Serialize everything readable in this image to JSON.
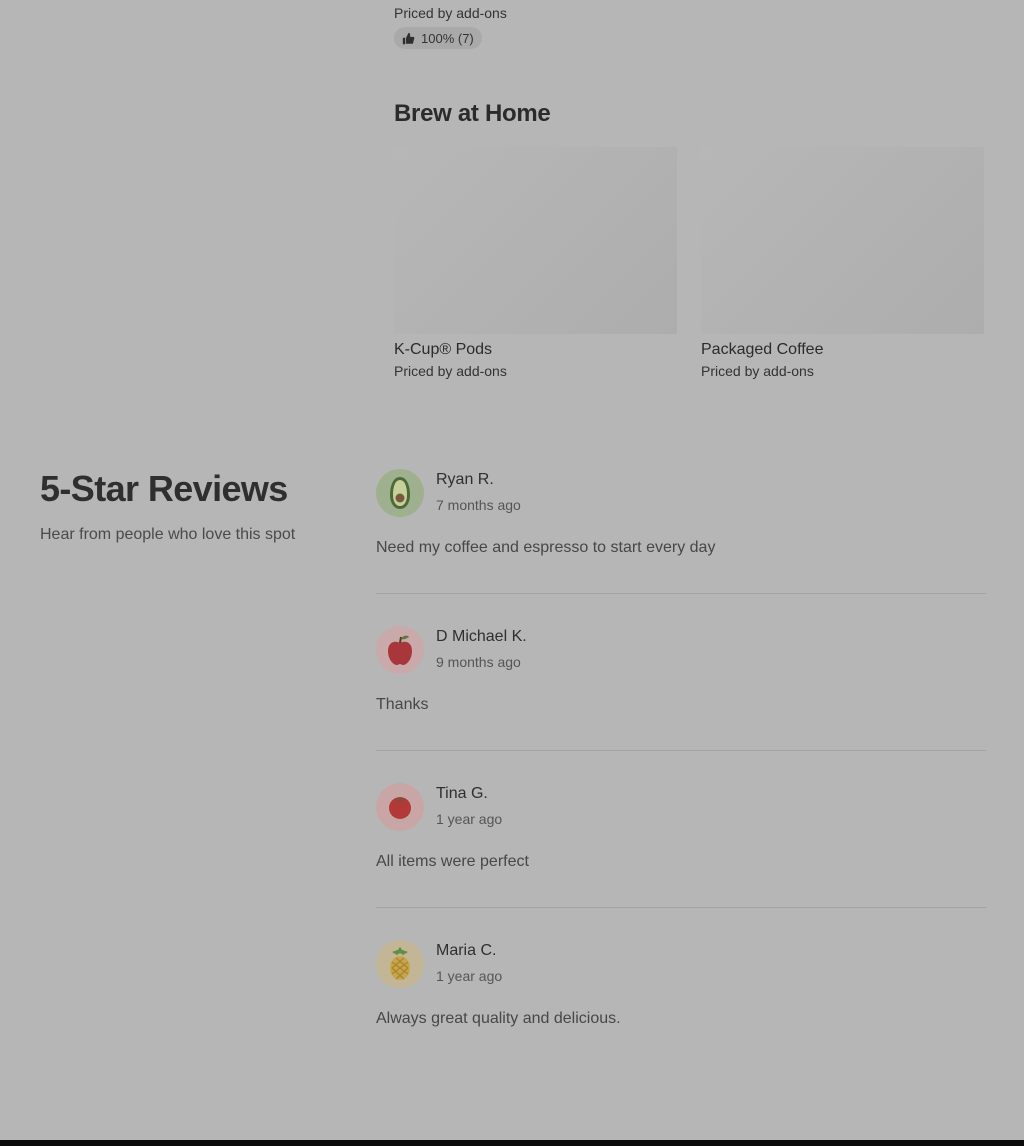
{
  "previous_item": {
    "price_text": "Priced by add-ons",
    "rating_text": "100% (7)",
    "rating_icon": "thumbs-up-icon"
  },
  "brew_at_home": {
    "title": "Brew at Home",
    "items": [
      {
        "name": "K-Cup® Pods",
        "price_text": "Priced by add-ons"
      },
      {
        "name": "Packaged Coffee",
        "price_text": "Priced by add-ons"
      }
    ]
  },
  "reviews": {
    "title": "5-Star Reviews",
    "subtitle": "Hear from people who love this spot",
    "items": [
      {
        "name": "Ryan R.",
        "time": "7 months ago",
        "text": "Need my coffee and espresso to start every day",
        "avatar_icon": "avocado-icon",
        "avatar_bg": "#9fb08e"
      },
      {
        "name": "D Michael K.",
        "time": "9 months ago",
        "text": "Thanks",
        "avatar_icon": "apple-icon",
        "avatar_bg": "#c9a9a9"
      },
      {
        "name": "Tina G.",
        "time": "1 year ago",
        "text": "All items were perfect",
        "avatar_icon": "tomato-icon",
        "avatar_bg": "#c9a6a6"
      },
      {
        "name": "Maria C.",
        "time": "1 year ago",
        "text": "Always great quality and delicious.",
        "avatar_icon": "pineapple-icon",
        "avatar_bg": "#c2b696"
      }
    ]
  }
}
